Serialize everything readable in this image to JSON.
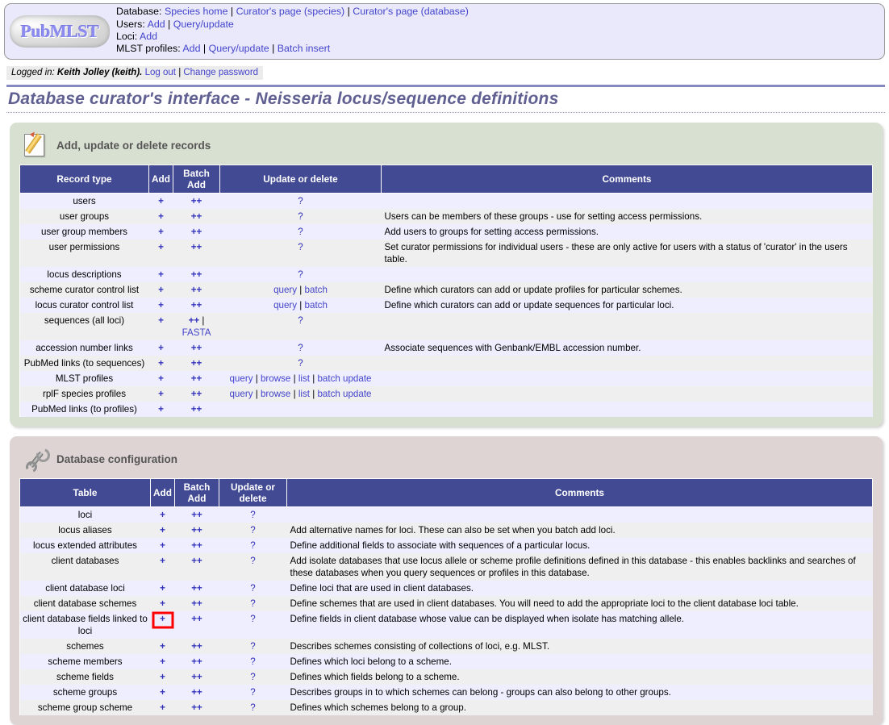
{
  "header": {
    "logo_text": "PubMLST",
    "nav_lines": [
      {
        "label": "Database:",
        "links": [
          "Species home",
          "Curator's page (species)",
          "Curator's page (database)"
        ]
      },
      {
        "label": "Users:",
        "links": [
          "Add",
          "Query/update"
        ]
      },
      {
        "label": "Loci:",
        "links": [
          "Add"
        ]
      },
      {
        "label": "MLST profiles:",
        "links": [
          "Add",
          "Query/update",
          "Batch insert"
        ]
      }
    ]
  },
  "login": {
    "prefix": "Logged in:",
    "user": "Keith Jolley (keith).",
    "logout": "Log out",
    "sep": "|",
    "change_password": "Change password"
  },
  "page_title": "Database curator's interface - Neisseria locus/sequence definitions",
  "colors": {
    "table_header": "#424a94",
    "row_odd": "#eeeeff",
    "row_even": "#efefef",
    "panel_records": "#d7e0d1",
    "panel_config": "#dfd4d4",
    "link": "#4444cc",
    "highlight_box": "#ff0000",
    "title": "#5f5f92"
  },
  "records_section": {
    "icon": "pencil-edit-icon",
    "title": "Add, update or delete records",
    "columns": [
      "Record type",
      "Add",
      "Batch Add",
      "Update or delete",
      "Comments"
    ],
    "rows": [
      {
        "name": "users",
        "add": "+",
        "batch": [
          "++"
        ],
        "update": [
          "?"
        ],
        "comment": ""
      },
      {
        "name": "user groups",
        "add": "+",
        "batch": [
          "++"
        ],
        "update": [
          "?"
        ],
        "comment": "Users can be members of these groups - use for setting access permissions."
      },
      {
        "name": "user group members",
        "add": "+",
        "batch": [
          "++"
        ],
        "update": [
          "?"
        ],
        "comment": "Add users to groups for setting access permissions."
      },
      {
        "name": "user permissions",
        "add": "+",
        "batch": [
          "++"
        ],
        "update": [
          "?"
        ],
        "comment": "Set curator permissions for individual users - these are only active for users with a status of 'curator' in the users table."
      },
      {
        "name": "locus descriptions",
        "add": "+",
        "batch": [
          "++"
        ],
        "update": [
          "?"
        ],
        "comment": ""
      },
      {
        "name": "scheme curator control list",
        "add": "+",
        "batch": [
          "++"
        ],
        "update": [
          "query",
          "batch"
        ],
        "comment": "Define which curators can add or update profiles for particular schemes."
      },
      {
        "name": "locus curator control list",
        "add": "+",
        "batch": [
          "++"
        ],
        "update": [
          "query",
          "batch"
        ],
        "comment": "Define which curators can add or update sequences for particular loci."
      },
      {
        "name": "sequences (all loci)",
        "add": "+",
        "batch": [
          "++",
          "FASTA"
        ],
        "update": [
          "?"
        ],
        "comment": ""
      },
      {
        "name": "accession number links",
        "add": "+",
        "batch": [
          "++"
        ],
        "update": [
          "?"
        ],
        "comment": "Associate sequences with Genbank/EMBL accession number."
      },
      {
        "name": "PubMed links (to sequences)",
        "add": "+",
        "batch": [
          "++"
        ],
        "update": [
          "?"
        ],
        "comment": ""
      },
      {
        "name": "MLST profiles",
        "add": "+",
        "batch": [
          "++"
        ],
        "update": [
          "query",
          "browse",
          "list",
          "batch update"
        ],
        "comment": ""
      },
      {
        "name": "rplF species profiles",
        "add": "+",
        "batch": [
          "++"
        ],
        "update": [
          "query",
          "browse",
          "list",
          "batch update"
        ],
        "comment": ""
      },
      {
        "name": "PubMed links (to profiles)",
        "add": "+",
        "batch": [
          "++"
        ],
        "update": [],
        "comment": ""
      }
    ]
  },
  "config_section": {
    "icon": "wrench-icon",
    "title": "Database configuration",
    "columns": [
      "Table",
      "Add",
      "Batch Add",
      "Update or delete",
      "Comments"
    ],
    "rows": [
      {
        "name": "loci",
        "add": "+",
        "batch": "++",
        "update": "?",
        "comment": "",
        "highlight": false
      },
      {
        "name": "locus aliases",
        "add": "+",
        "batch": "++",
        "update": "?",
        "comment": "Add alternative names for loci. These can also be set when you batch add loci.",
        "highlight": false
      },
      {
        "name": "locus extended attributes",
        "add": "+",
        "batch": "++",
        "update": "?",
        "comment": "Define additional fields to associate with sequences of a particular locus.",
        "highlight": false
      },
      {
        "name": "client databases",
        "add": "+",
        "batch": "++",
        "update": "?",
        "comment": "Add isolate databases that use locus allele or scheme profile definitions defined in this database - this enables backlinks and searches of these databases when you query sequences or profiles in this database.",
        "highlight": false
      },
      {
        "name": "client database loci",
        "add": "+",
        "batch": "++",
        "update": "?",
        "comment": "Define loci that are used in client databases.",
        "highlight": false
      },
      {
        "name": "client database schemes",
        "add": "+",
        "batch": "++",
        "update": "?",
        "comment": "Define schemes that are used in client databases. You will need to add the appropriate loci to the client database loci table.",
        "highlight": false
      },
      {
        "name": "client database fields linked to loci",
        "add": "+",
        "batch": "++",
        "update": "?",
        "comment": "Define fields in client database whose value can be displayed when isolate has matching allele.",
        "highlight": true
      },
      {
        "name": "schemes",
        "add": "+",
        "batch": "++",
        "update": "?",
        "comment": "Describes schemes consisting of collections of loci, e.g. MLST.",
        "highlight": false
      },
      {
        "name": "scheme members",
        "add": "+",
        "batch": "++",
        "update": "?",
        "comment": "Defines which loci belong to a scheme.",
        "highlight": false
      },
      {
        "name": "scheme fields",
        "add": "+",
        "batch": "++",
        "update": "?",
        "comment": "Defines which fields belong to a scheme.",
        "highlight": false
      },
      {
        "name": "scheme groups",
        "add": "+",
        "batch": "++",
        "update": "?",
        "comment": "Describes groups in to which schemes can belong - groups can also belong to other groups.",
        "highlight": false
      },
      {
        "name": "scheme group scheme",
        "add": "+",
        "batch": "++",
        "update": "?",
        "comment": "Defines which schemes belong to a group.",
        "highlight": false
      }
    ]
  }
}
